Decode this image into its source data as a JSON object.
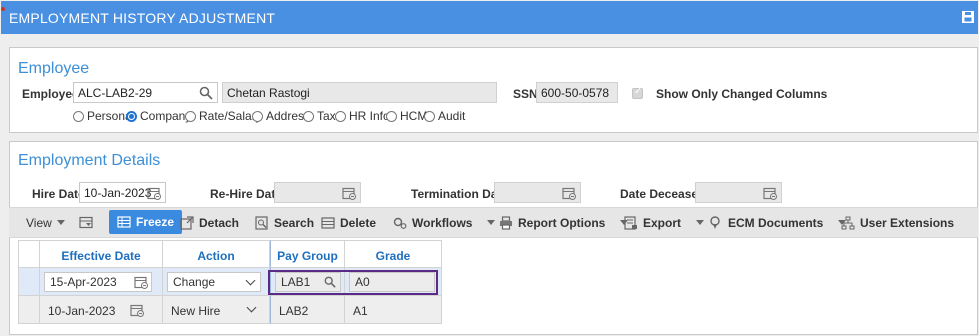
{
  "window": {
    "title": "EMPLOYMENT HISTORY ADJUSTMENT"
  },
  "employee_section": {
    "heading": "Employee",
    "employee_label": "Employee",
    "employee_value": "ALC-LAB2-29",
    "name_value": "Chetan  Rastogi",
    "ssn_label": "SSN",
    "ssn_value": "600-50-0578",
    "show_changed_label": "Show Only Changed Columns",
    "show_changed_checked": true,
    "radios": [
      {
        "label": "Personal",
        "selected": false
      },
      {
        "label": "Company",
        "selected": true
      },
      {
        "label": "Rate/Salary",
        "selected": false
      },
      {
        "label": "Address",
        "selected": false
      },
      {
        "label": "Tax",
        "selected": false
      },
      {
        "label": "HR Info.",
        "selected": false
      },
      {
        "label": "HCM",
        "selected": false
      },
      {
        "label": "Audit",
        "selected": false
      }
    ]
  },
  "details_section": {
    "heading": "Employment Details",
    "hire_date_label": "Hire Date",
    "hire_date_value": "10-Jan-2023",
    "rehire_date_label": "Re-Hire Date",
    "rehire_date_value": "",
    "termination_date_label": "Termination Date",
    "termination_date_value": "",
    "date_deceased_label": "Date Deceased",
    "date_deceased_value": ""
  },
  "toolbar": {
    "view": "View",
    "freeze": "Freeze",
    "detach": "Detach",
    "search": "Search",
    "delete": "Delete",
    "workflows": "Workflows",
    "report_options": "Report Options",
    "export": "Export",
    "ecm_documents": "ECM Documents",
    "user_extensions": "User Extensions"
  },
  "grid": {
    "columns": [
      "Effective Date",
      "Action",
      "Pay Group",
      "Grade"
    ],
    "rows": [
      {
        "effective_date": "15-Apr-2023",
        "action": "Change",
        "pay_group": "LAB1",
        "grade": "A0"
      },
      {
        "effective_date": "10-Jan-2023",
        "action": "New Hire",
        "pay_group": "LAB2",
        "grade": "A1"
      }
    ]
  },
  "colors": {
    "titlebar": "#4a90e2",
    "heading": "#3d8fd6",
    "freeze_button": "#3a8be0",
    "highlight_box": "#5b2a86"
  }
}
